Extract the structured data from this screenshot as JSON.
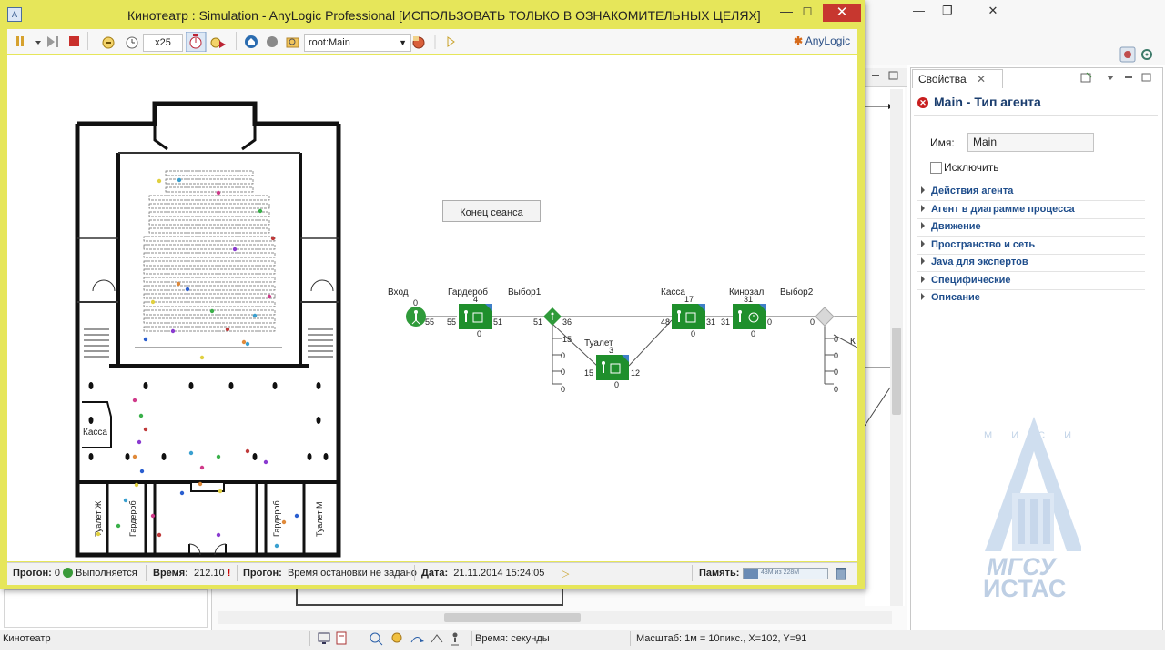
{
  "ide": {
    "window_buttons": {
      "minimize": "—",
      "restore": "❐",
      "close": "✕"
    },
    "properties_tab": "Свойства",
    "properties_header": "Main - Тип агента",
    "name_label": "Имя:",
    "name_value": "Main",
    "exclude_label": "Исключить",
    "sections": [
      "Действия агента",
      "Агент в диаграмме процесса",
      "Движение",
      "Пространство и сеть",
      "Java для экспертов",
      "Специфические",
      "Описание"
    ],
    "watermark": {
      "top": "М И С И",
      "line1": "МГСУ",
      "line2": "ИСТАС"
    }
  },
  "statusbar": {
    "left_text": "Кинотеатр",
    "time_units": "Время: секунды",
    "scale_text": "Масштаб: 1м = 10пикс., X=102, Y=91"
  },
  "simulation": {
    "title": "Кинотеатр : Simulation - AnyLogic Professional [ИСПОЛЬЗОВАТЬ ТОЛЬКО В ОЗНАКОМИТЕЛЬНЫХ ЦЕЛЯХ]",
    "app_icon": "A",
    "window_buttons": {
      "minimize": "—",
      "restore": "☐",
      "close": "✕"
    },
    "speed": "x25",
    "agent_selector": "root:Main",
    "logo": "AnyLogic",
    "end_session_button": "Конец сеанса",
    "floorplan": {
      "kassa": "Касса",
      "toilet_w": "Туалет Ж",
      "wardrobe_left": "Гардероб",
      "wardrobe_right": "Гардероб",
      "toilet_m": "Туалет М"
    },
    "flow": {
      "vhod": {
        "label": "Вход",
        "top": "0",
        "out": "55"
      },
      "garderob": {
        "label": "Гардероб",
        "top": "4",
        "in": "55",
        "out": "51",
        "bottom": "0"
      },
      "vybor1": {
        "label": "Выбор1",
        "in": "51",
        "out": "36",
        "branch": [
          "15",
          "0",
          "0",
          "0"
        ]
      },
      "tualet": {
        "label": "Туалет",
        "top": "3",
        "in": "15",
        "out": "12",
        "bottom": "0"
      },
      "kassa": {
        "label": "Касса",
        "top": "17",
        "in": "48",
        "out": "31",
        "bottom": "0"
      },
      "kinozal": {
        "label": "Кинозал",
        "top": "31",
        "in": "31",
        "out": "0",
        "bottom": "0"
      },
      "vybor2": {
        "label": "Выбор2",
        "in": "0",
        "branch": [
          "0",
          "0",
          "0",
          "0"
        ]
      },
      "cut_label": "К"
    },
    "status": {
      "run_label": "Прогон:",
      "run_number": "0",
      "run_state": "Выполняется",
      "time_label": "Время:",
      "time_value": "212.10",
      "stop_label": "Прогон:",
      "stop_value": "Время остановки не задано",
      "date_label": "Дата:",
      "date_value": "21.11.2014 15:24:05",
      "memory_label": "Память:",
      "memory_value": "43M из 228M"
    }
  }
}
